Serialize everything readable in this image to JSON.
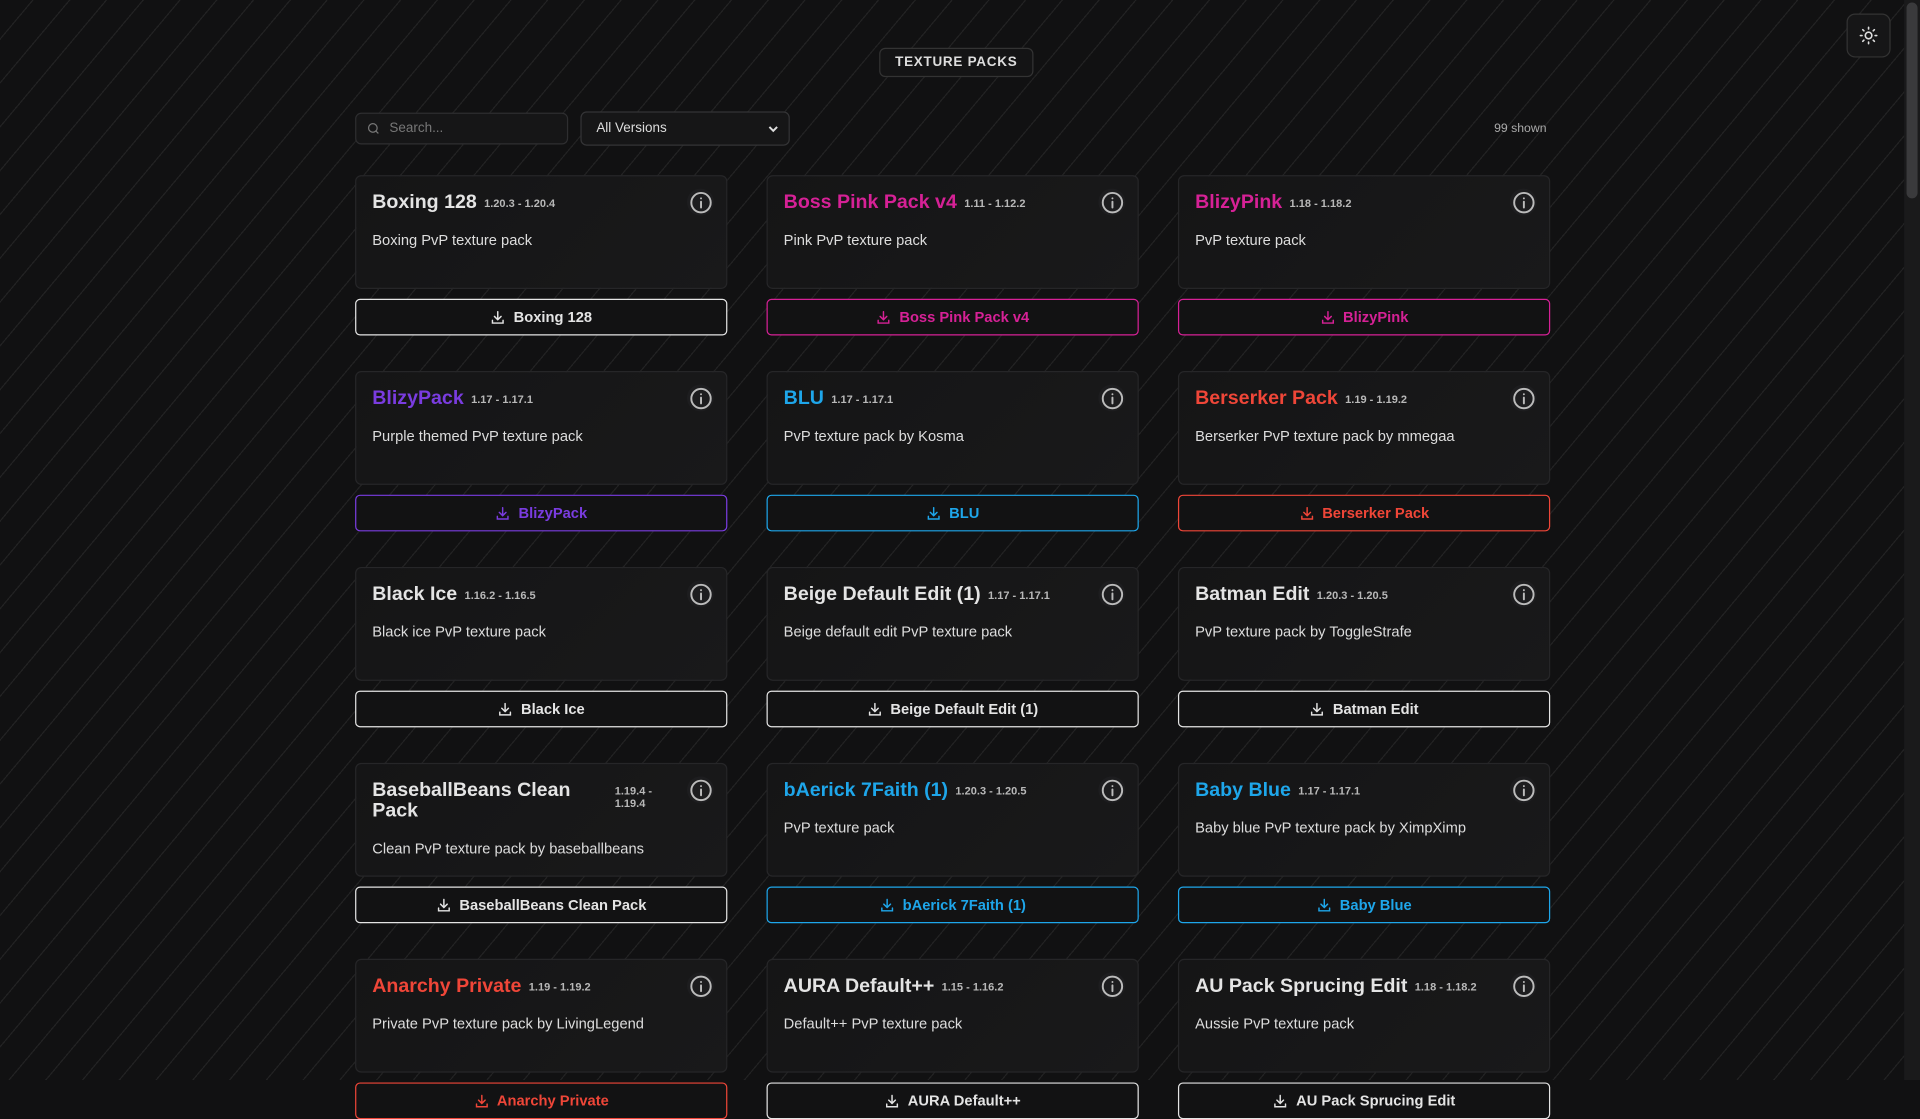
{
  "header": {
    "badge": "TEXTURE PACKS",
    "theme_toggle_icon": "sun-icon"
  },
  "filters": {
    "search_placeholder": "Search...",
    "search_value": "",
    "version_selected": "All Versions",
    "count": "99 shown"
  },
  "colors": {
    "white": "#e4e4e4",
    "pink": "#d62196",
    "purple": "#7a3ce0",
    "blue": "#1ea6ea",
    "red": "#ef4638"
  },
  "packs": [
    {
      "name": "Boxing 128",
      "versions": "1.20.3 - 1.20.4",
      "description": "Boxing PvP texture pack",
      "color": "white"
    },
    {
      "name": "Boss Pink Pack v4",
      "versions": "1.11 - 1.12.2",
      "description": "Pink PvP texture pack",
      "color": "pink"
    },
    {
      "name": "BlizyPink",
      "versions": "1.18 - 1.18.2",
      "description": "PvP texture pack",
      "color": "pink"
    },
    {
      "name": "BlizyPack",
      "versions": "1.17 - 1.17.1",
      "description": "Purple themed PvP texture pack",
      "color": "purple"
    },
    {
      "name": "BLU",
      "versions": "1.17 - 1.17.1",
      "description": "PvP texture pack by Kosma",
      "color": "blue"
    },
    {
      "name": "Berserker Pack",
      "versions": "1.19 - 1.19.2",
      "description": "Berserker PvP texture pack by mmegaa",
      "color": "red"
    },
    {
      "name": "Black Ice",
      "versions": "1.16.2 - 1.16.5",
      "description": "Black ice PvP texture pack",
      "color": "white"
    },
    {
      "name": "Beige Default Edit (1)",
      "versions": "1.17 - 1.17.1",
      "description": "Beige default edit PvP texture pack",
      "color": "white"
    },
    {
      "name": "Batman Edit",
      "versions": "1.20.3 - 1.20.5",
      "description": "PvP texture pack by ToggleStrafe",
      "color": "white"
    },
    {
      "name": "BaseballBeans Clean Pack",
      "versions": "1.19.4 - 1.19.4",
      "description": "Clean PvP texture pack by baseballbeans",
      "color": "white"
    },
    {
      "name": "bAerick 7Faith (1)",
      "versions": "1.20.3 - 1.20.5",
      "description": "PvP texture pack",
      "color": "blue"
    },
    {
      "name": "Baby Blue",
      "versions": "1.17 - 1.17.1",
      "description": "Baby blue PvP texture pack by XimpXimp",
      "color": "blue"
    },
    {
      "name": "Anarchy Private",
      "versions": "1.19 - 1.19.2",
      "description": "Private PvP texture pack by LivingLegend",
      "color": "red"
    },
    {
      "name": "AURA Default++",
      "versions": "1.15 - 1.16.2",
      "description": "Default++ PvP texture pack",
      "color": "white"
    },
    {
      "name": "AU Pack Sprucing Edit",
      "versions": "1.18 - 1.18.2",
      "description": "Aussie PvP texture pack",
      "color": "white"
    }
  ]
}
